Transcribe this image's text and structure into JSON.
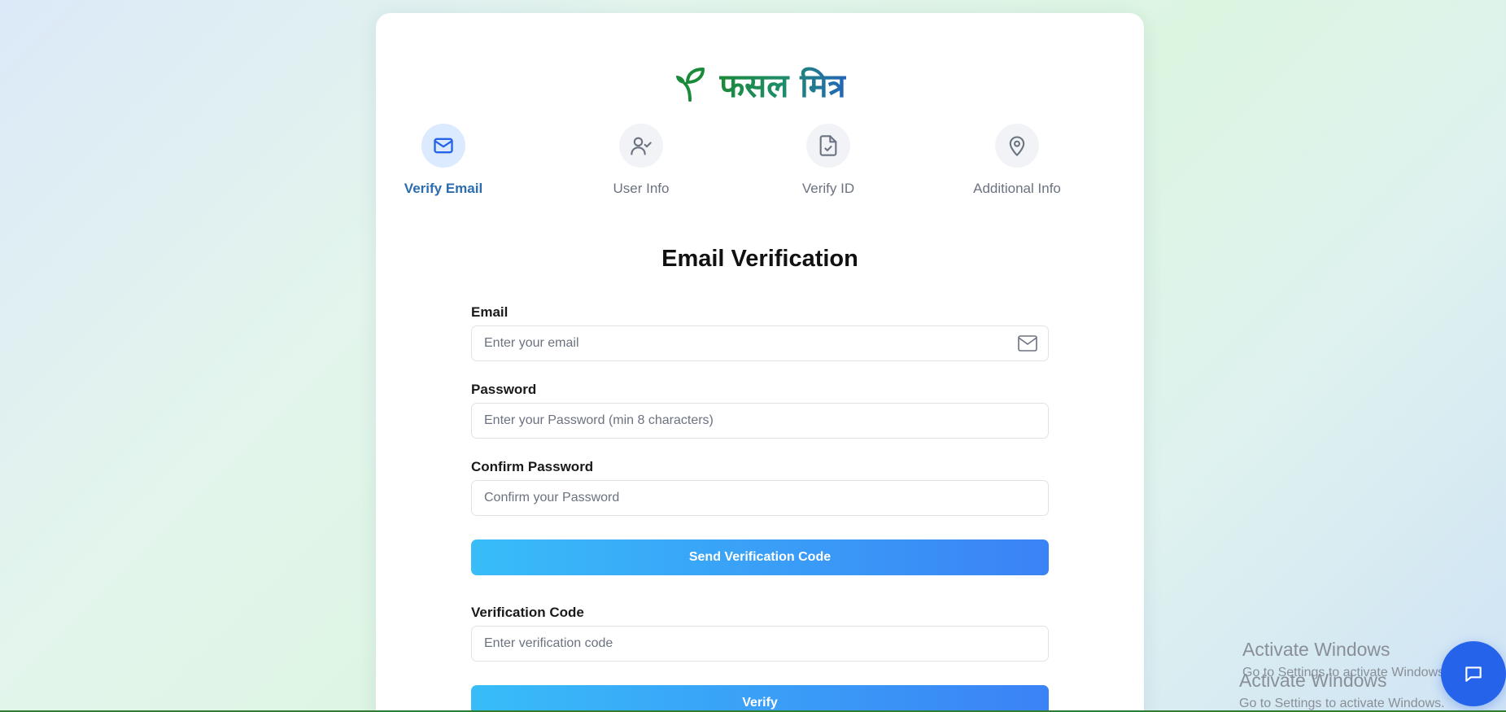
{
  "brand": {
    "name": "फसल मित्र",
    "logo_icon": "sprout-icon",
    "colors": {
      "green": "#1b8a3a",
      "blue": "#2466b8"
    }
  },
  "steps": [
    {
      "label": "Verify Email",
      "icon": "mail-icon",
      "active": true
    },
    {
      "label": "User Info",
      "icon": "user-check-icon",
      "active": false
    },
    {
      "label": "Verify ID",
      "icon": "file-check-icon",
      "active": false
    },
    {
      "label": "Additional Info",
      "icon": "map-pin-icon",
      "active": false
    }
  ],
  "form": {
    "title": "Email Verification",
    "email": {
      "label": "Email",
      "placeholder": "Enter your email",
      "value": ""
    },
    "password": {
      "label": "Password",
      "placeholder": "Enter your Password (min 8 characters)",
      "value": ""
    },
    "confirm_password": {
      "label": "Confirm Password",
      "placeholder": "Confirm your Password",
      "value": ""
    },
    "send_button": "Send Verification Code",
    "code": {
      "label": "Verification Code",
      "placeholder": "Enter verification code",
      "value": ""
    },
    "verify_button": "Verify"
  },
  "accent_gradient": [
    "#38bdf8",
    "#3b82f6"
  ],
  "watermark": {
    "title": "Activate Windows",
    "subtitle": "Go to Settings to activate Windows."
  },
  "chat_button": {
    "icon": "chat-icon",
    "color": "#2563eb"
  }
}
